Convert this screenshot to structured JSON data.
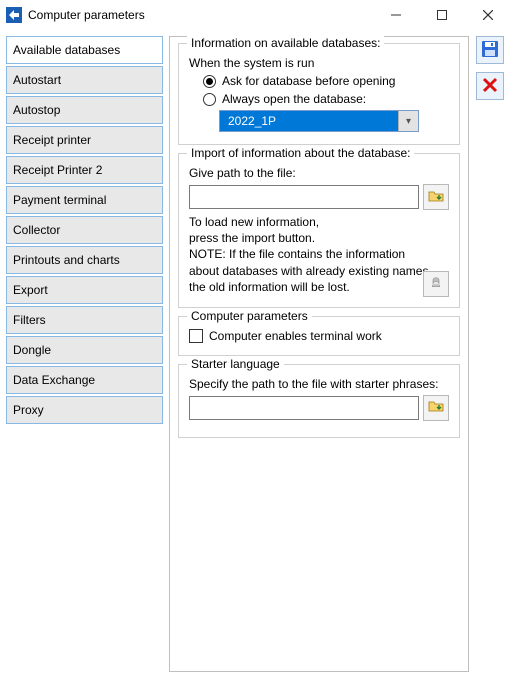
{
  "window": {
    "title": "Computer parameters"
  },
  "sidebar": {
    "items": [
      {
        "label": "Available databases",
        "active": true
      },
      {
        "label": "Autostart"
      },
      {
        "label": "Autostop"
      },
      {
        "label": "Receipt printer"
      },
      {
        "label": "Receipt Printer 2"
      },
      {
        "label": "Payment terminal"
      },
      {
        "label": "Collector"
      },
      {
        "label": "Printouts and charts"
      },
      {
        "label": "Export"
      },
      {
        "label": "Filters"
      },
      {
        "label": "Dongle"
      },
      {
        "label": "Data Exchange"
      },
      {
        "label": "Proxy"
      }
    ]
  },
  "info_group": {
    "title": "Information on available databases:",
    "subtitle": "When the system is run",
    "option_ask": "Ask for database before opening",
    "option_always": "Always open the database:",
    "selected_db": "2022_1P"
  },
  "import_group": {
    "title": "Import of information about the database:",
    "path_label": "Give path to the file:",
    "path_value": "",
    "line1": "To load new information,",
    "line2": "press the import button.",
    "note1": "NOTE: If the file contains the information",
    "note2": "about databases with already existing names,",
    "note3": "the old information will be lost."
  },
  "params_group": {
    "title": "Computer parameters",
    "checkbox_label": "Computer enables terminal work"
  },
  "lang_group": {
    "title": "Starter language",
    "path_label": "Specify the path to the file with starter phrases:",
    "path_value": ""
  }
}
